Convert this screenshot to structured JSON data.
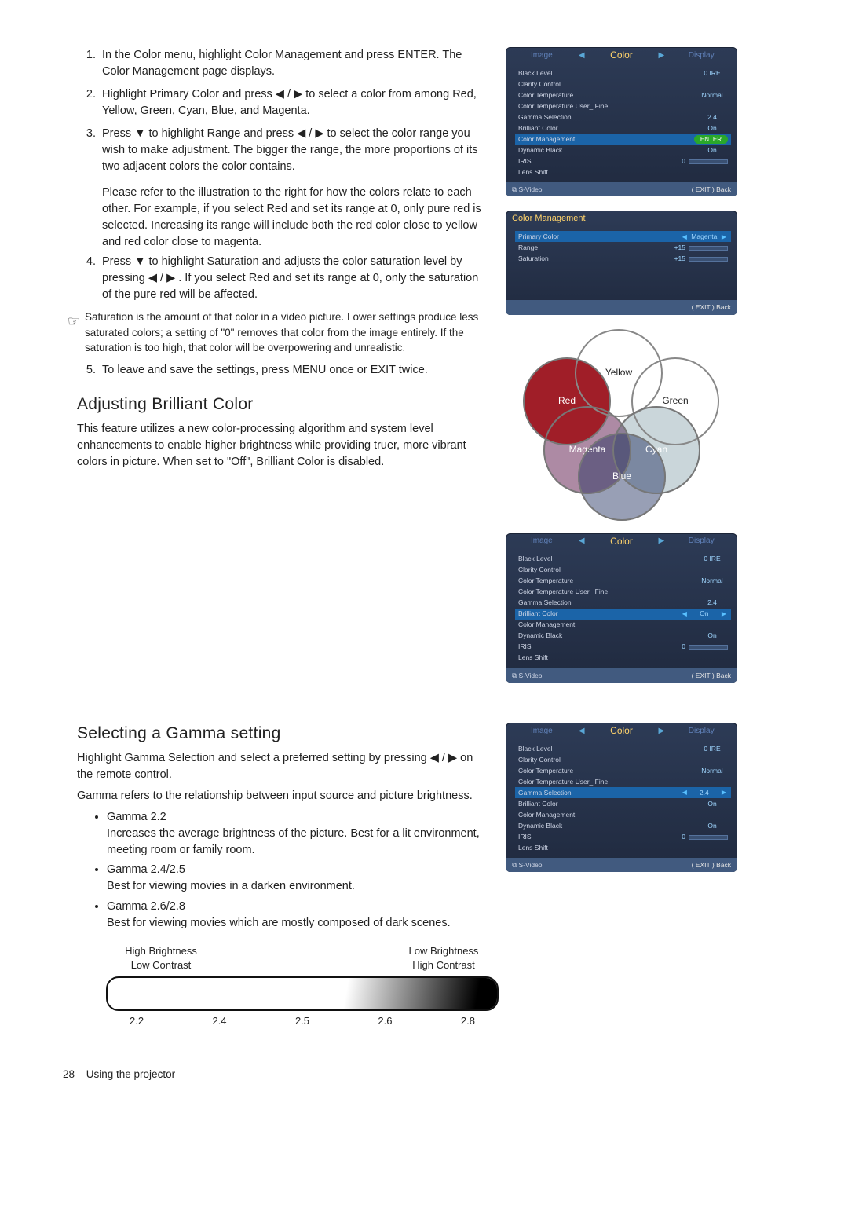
{
  "steps_a": [
    "In the Color menu, highlight Color Management and press ENTER. The Color Management page displays.",
    "Highlight Primary Color and press ◀ / ▶ to select a color from among Red, Yellow, Green, Cyan, Blue, and Magenta.",
    "Press ▼ to highlight Range and press ◀ / ▶ to select the color range you wish to make adjustment. The bigger the range, the more proportions of its two adjacent colors the color contains."
  ],
  "para1": "Please refer to the illustration to the right for how the colors relate to each other. For example, if you select Red and set its range at 0, only pure red is selected. Increasing its range will include both the red color close to yellow and red color close to magenta.",
  "steps_b": [
    "Press ▼ to highlight Saturation and adjusts the color saturation level by pressing ◀ / ▶ .\nIf you select Red and set its range at 0, only the saturation of the pure red will be affected."
  ],
  "note": "Saturation is the amount of that color in a video picture. Lower settings produce less saturated colors; a setting of \"0\" removes that color from the image entirely. If the saturation is too high, that color will be overpowering and unrealistic.",
  "steps_c": [
    "To leave and save the settings, press MENU once or EXIT twice."
  ],
  "h_brilliant": "Adjusting Brilliant Color",
  "p_brilliant": "This feature utilizes a new color-processing algorithm and system level enhancements to enable higher brightness while providing truer, more vibrant colors in picture. When set to \"Off\", Brilliant Color is disabled.",
  "h_gamma": "Selecting a Gamma setting",
  "p_gamma1": "Highlight Gamma Selection and select a preferred setting by pressing ◀ / ▶ on the remote control.",
  "p_gamma2": "Gamma refers to the relationship between input source and picture brightness.",
  "gamma_items": [
    {
      "h": "Gamma 2.2",
      "p": "Increases the average brightness of the picture. Best for a lit environment, meeting room or family room."
    },
    {
      "h": "Gamma 2.4/2.5",
      "p": "Best for viewing movies in a darken environment."
    },
    {
      "h": "Gamma 2.6/2.8",
      "p": "Best for viewing movies which are mostly composed of dark scenes."
    }
  ],
  "gamma_labels": {
    "left1": "High Brightness",
    "left2": "Low Contrast",
    "right1": "Low Brightness",
    "right2": "High Contrast"
  },
  "gamma_nums": [
    "2.2",
    "2.4",
    "2.5",
    "2.6",
    "2.8"
  ],
  "venn": {
    "red": "Red",
    "yellow": "Yellow",
    "green": "Green",
    "magenta": "Magenta",
    "cyan": "Cyan",
    "blue": "Blue"
  },
  "osd_tabs": {
    "left": "Image",
    "mid": "Color",
    "right": "Display"
  },
  "osd1_rows": [
    {
      "l": "Black Level",
      "v": "0 IRE"
    },
    {
      "l": "Clarity Control",
      "v": ""
    },
    {
      "l": "Color Temperature",
      "v": "Normal"
    },
    {
      "l": "Color Temperature User_ Fine",
      "v": ""
    },
    {
      "l": "Gamma Selection",
      "v": "2.4"
    },
    {
      "l": "Brilliant Color",
      "v": "On"
    },
    {
      "l": "Color Management",
      "v": "ENTER",
      "hl": true,
      "enter": true
    },
    {
      "l": "Dynamic Black",
      "v": "On"
    },
    {
      "l": "IRIS",
      "v": "0",
      "slider": true
    },
    {
      "l": "Lens Shift",
      "v": ""
    }
  ],
  "osd_cm_title": "Color Management",
  "osd_cm_rows": [
    {
      "l": "Primary Color",
      "v": "Magenta",
      "hl": true,
      "arrows": true
    },
    {
      "l": "Range",
      "v": "+15",
      "slider": true
    },
    {
      "l": "Saturation",
      "v": "+15",
      "slider": true
    }
  ],
  "osd2_rows": [
    {
      "l": "Black Level",
      "v": "0 IRE"
    },
    {
      "l": "Clarity Control",
      "v": ""
    },
    {
      "l": "Color Temperature",
      "v": "Normal"
    },
    {
      "l": "Color Temperature User_ Fine",
      "v": ""
    },
    {
      "l": "Gamma Selection",
      "v": "2.4"
    },
    {
      "l": "Brilliant Color",
      "v": "On",
      "hl": true,
      "arrows": true
    },
    {
      "l": "Color Management",
      "v": ""
    },
    {
      "l": "Dynamic Black",
      "v": "On"
    },
    {
      "l": "IRIS",
      "v": "0",
      "slider": true
    },
    {
      "l": "Lens Shift",
      "v": ""
    }
  ],
  "osd3_rows": [
    {
      "l": "Black Level",
      "v": "0 IRE"
    },
    {
      "l": "Clarity Control",
      "v": ""
    },
    {
      "l": "Color Temperature",
      "v": "Normal"
    },
    {
      "l": "Color Temperature User_ Fine",
      "v": ""
    },
    {
      "l": "Gamma Selection",
      "v": "2.4",
      "hl": true,
      "arrows": true
    },
    {
      "l": "Brilliant Color",
      "v": "On"
    },
    {
      "l": "Color Management",
      "v": ""
    },
    {
      "l": "Dynamic Black",
      "v": "On"
    },
    {
      "l": "IRIS",
      "v": "0",
      "slider": true
    },
    {
      "l": "Lens Shift",
      "v": ""
    }
  ],
  "osd_foot": {
    "src": "S-Video",
    "exit": "( EXIT ) Back"
  },
  "footer": {
    "page": "28",
    "title": "Using the projector"
  }
}
